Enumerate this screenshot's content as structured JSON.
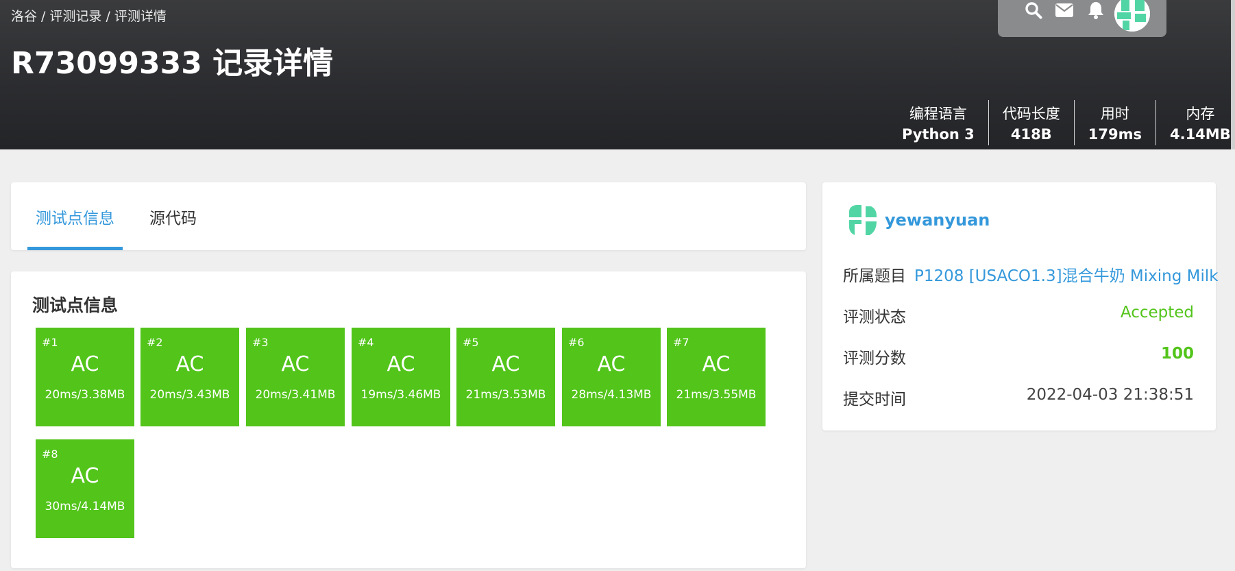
{
  "breadcrumb": [
    "洛谷",
    "评测记录",
    "评测详情"
  ],
  "breadcrumb_sep": "/",
  "page_title": "R73099333 记录详情",
  "nav_icons": [
    "search-icon",
    "mail-icon",
    "bell-icon"
  ],
  "stats": [
    {
      "label": "编程语言",
      "value": "Python 3"
    },
    {
      "label": "代码长度",
      "value": "418B"
    },
    {
      "label": "用时",
      "value": "179ms"
    },
    {
      "label": "内存",
      "value": "4.14MB"
    }
  ],
  "tabs": [
    {
      "label": "测试点信息",
      "active": true
    },
    {
      "label": "源代码",
      "active": false
    }
  ],
  "cases_title": "测试点信息",
  "cases": [
    {
      "num": "#1",
      "status": "AC",
      "time": "20ms/3.38MB"
    },
    {
      "num": "#2",
      "status": "AC",
      "time": "20ms/3.43MB"
    },
    {
      "num": "#3",
      "status": "AC",
      "time": "20ms/3.41MB"
    },
    {
      "num": "#4",
      "status": "AC",
      "time": "19ms/3.46MB"
    },
    {
      "num": "#5",
      "status": "AC",
      "time": "21ms/3.53MB"
    },
    {
      "num": "#6",
      "status": "AC",
      "time": "28ms/4.13MB"
    },
    {
      "num": "#7",
      "status": "AC",
      "time": "21ms/3.55MB"
    },
    {
      "num": "#8",
      "status": "AC",
      "time": "30ms/4.14MB"
    }
  ],
  "user": {
    "name": "yewanyuan"
  },
  "info": {
    "problem_label": "所属题目",
    "problem": "P1208 [USACO1.3]混合牛奶 Mixing Milk",
    "status_label": "评测状态",
    "status": "Accepted",
    "score_label": "评测分数",
    "score": "100",
    "time_label": "提交时间",
    "time": "2022-04-03 21:38:51"
  },
  "colors": {
    "accent": "#3498db",
    "ac_green": "#52c41a",
    "header_dark": "#2c2d30",
    "avatar_green": "#52d5a5"
  }
}
